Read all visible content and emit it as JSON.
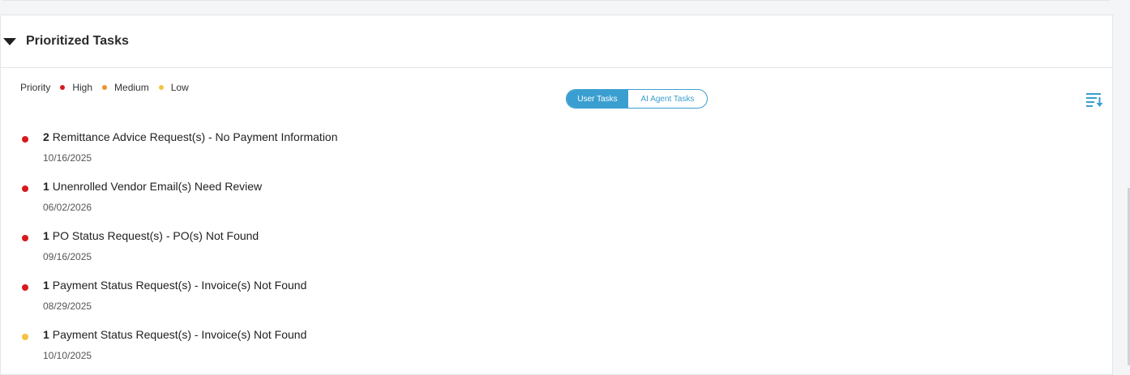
{
  "panel": {
    "title": "Prioritized Tasks"
  },
  "legend": {
    "label": "Priority",
    "items": [
      {
        "label": "High",
        "color": "#d7191c"
      },
      {
        "label": "Medium",
        "color": "#f0922b"
      },
      {
        "label": "Low",
        "color": "#f5c342"
      }
    ]
  },
  "toggle": {
    "user_tasks": "User Tasks",
    "ai_agent_tasks": "AI Agent Tasks",
    "active": "User Tasks"
  },
  "colors": {
    "accent": "#3a9ed0",
    "high": "#d7191c",
    "medium": "#f0922b",
    "low": "#f5c342"
  },
  "tasks": [
    {
      "count": "2",
      "text": "Remittance Advice Request(s) - No Payment Information",
      "date": "10/16/2025",
      "priority": "High"
    },
    {
      "count": "1",
      "text": "Unenrolled Vendor Email(s) Need Review",
      "date": "06/02/2026",
      "priority": "High"
    },
    {
      "count": "1",
      "text": "PO Status Request(s) - PO(s) Not Found",
      "date": "09/16/2025",
      "priority": "High"
    },
    {
      "count": "1",
      "text": "Payment Status Request(s) - Invoice(s) Not Found",
      "date": "08/29/2025",
      "priority": "High"
    },
    {
      "count": "1",
      "text": "Payment Status Request(s) - Invoice(s) Not Found",
      "date": "10/10/2025",
      "priority": "Low"
    }
  ],
  "icons": {
    "collapse": "caret-down-icon",
    "sort": "sort-descending-icon"
  }
}
